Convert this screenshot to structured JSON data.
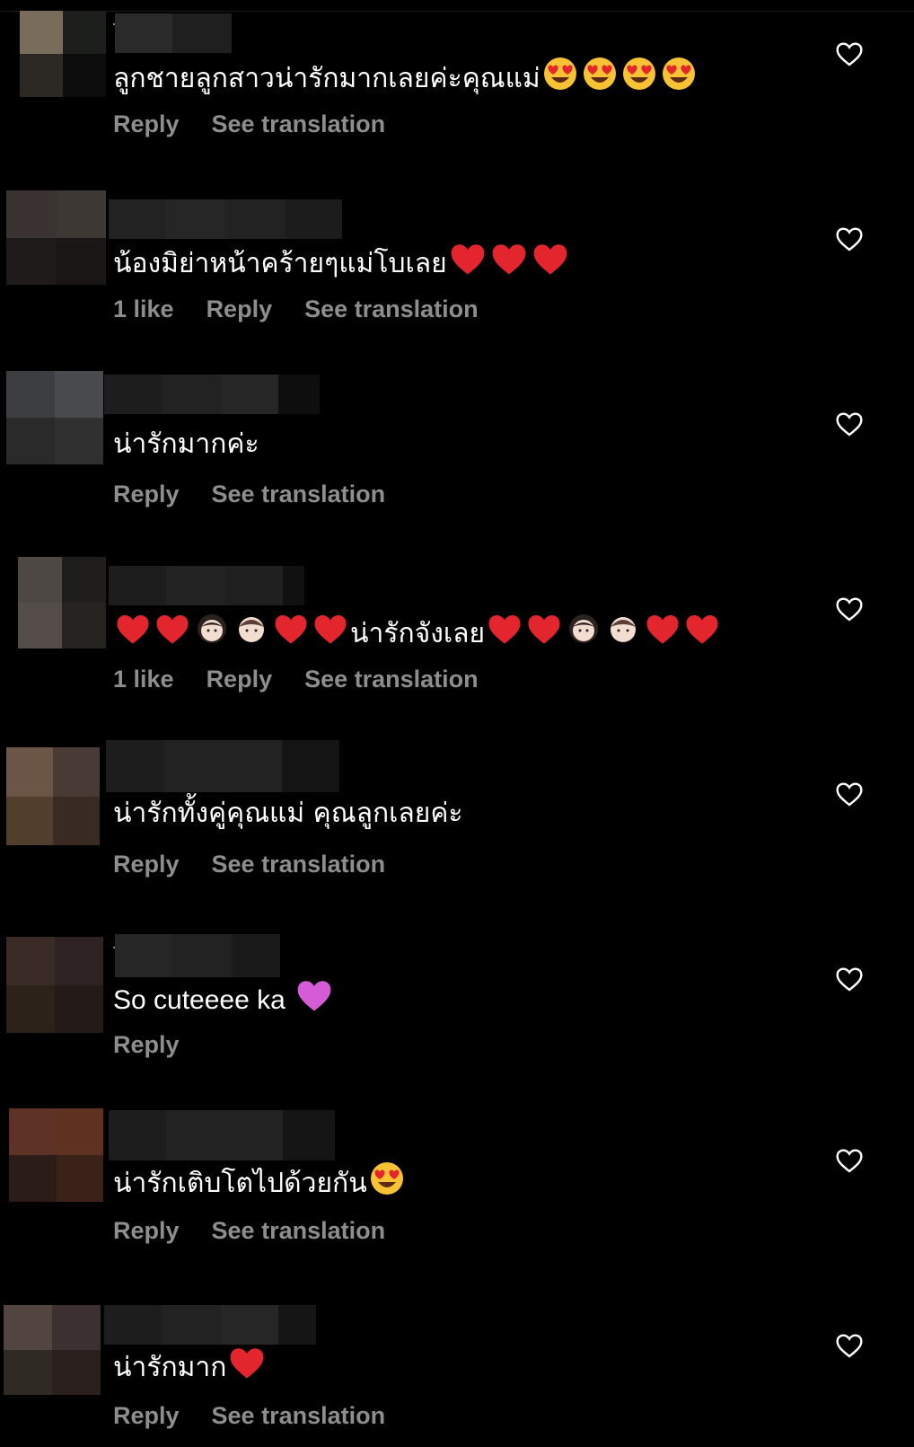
{
  "comments": [
    {
      "text": "ลูกชายลูกสาวน่ารักมากเลยค่ะคุณแม่",
      "emoji": [
        "heart-eyes",
        "heart-eyes",
        "heart-eyes",
        "heart-eyes"
      ],
      "likes": "",
      "reply": "Reply",
      "translate": "See translation"
    },
    {
      "text": "น้องมิย่าหน้าคร้ายๆแม่โบเลย",
      "emoji": [
        "red-heart",
        "red-heart",
        "red-heart"
      ],
      "likes": "1 like",
      "reply": "Reply",
      "translate": "See translation"
    },
    {
      "text": "น่ารักมากค่ะ",
      "emoji": [],
      "likes": "",
      "reply": "Reply",
      "translate": "See translation"
    },
    {
      "text_before": "",
      "text": "น่ารักจังเลย",
      "likes": "1 like",
      "reply": "Reply",
      "translate": "See translation"
    },
    {
      "text": "น่ารักทั้งคู่คุณแม่ คุณลูกเลยค่ะ",
      "emoji": [],
      "likes": "",
      "reply": "Reply",
      "translate": "See translation"
    },
    {
      "text": "So cuteeee ka",
      "emoji": [
        "purple-heart"
      ],
      "likes": "",
      "reply": "Reply",
      "translate": ""
    },
    {
      "text": "น่ารักเติบโตไปด้วยกัน",
      "emoji": [
        "heart-eyes"
      ],
      "likes": "",
      "reply": "Reply",
      "translate": "See translation"
    },
    {
      "text": "น่ารักมาก",
      "emoji": [
        "red-heart"
      ],
      "likes": "",
      "reply": "Reply",
      "translate": "See translation"
    }
  ],
  "colors": {
    "background": "#000000",
    "meta": "#8e8e8e",
    "text": "#ffffff",
    "red_heart": "#e3262e",
    "purple_heart": "#d65bd6",
    "emoji_face": "#f7c233"
  },
  "icons": {
    "like": "heart-outline-icon",
    "avatar": "pixelated-avatar"
  }
}
